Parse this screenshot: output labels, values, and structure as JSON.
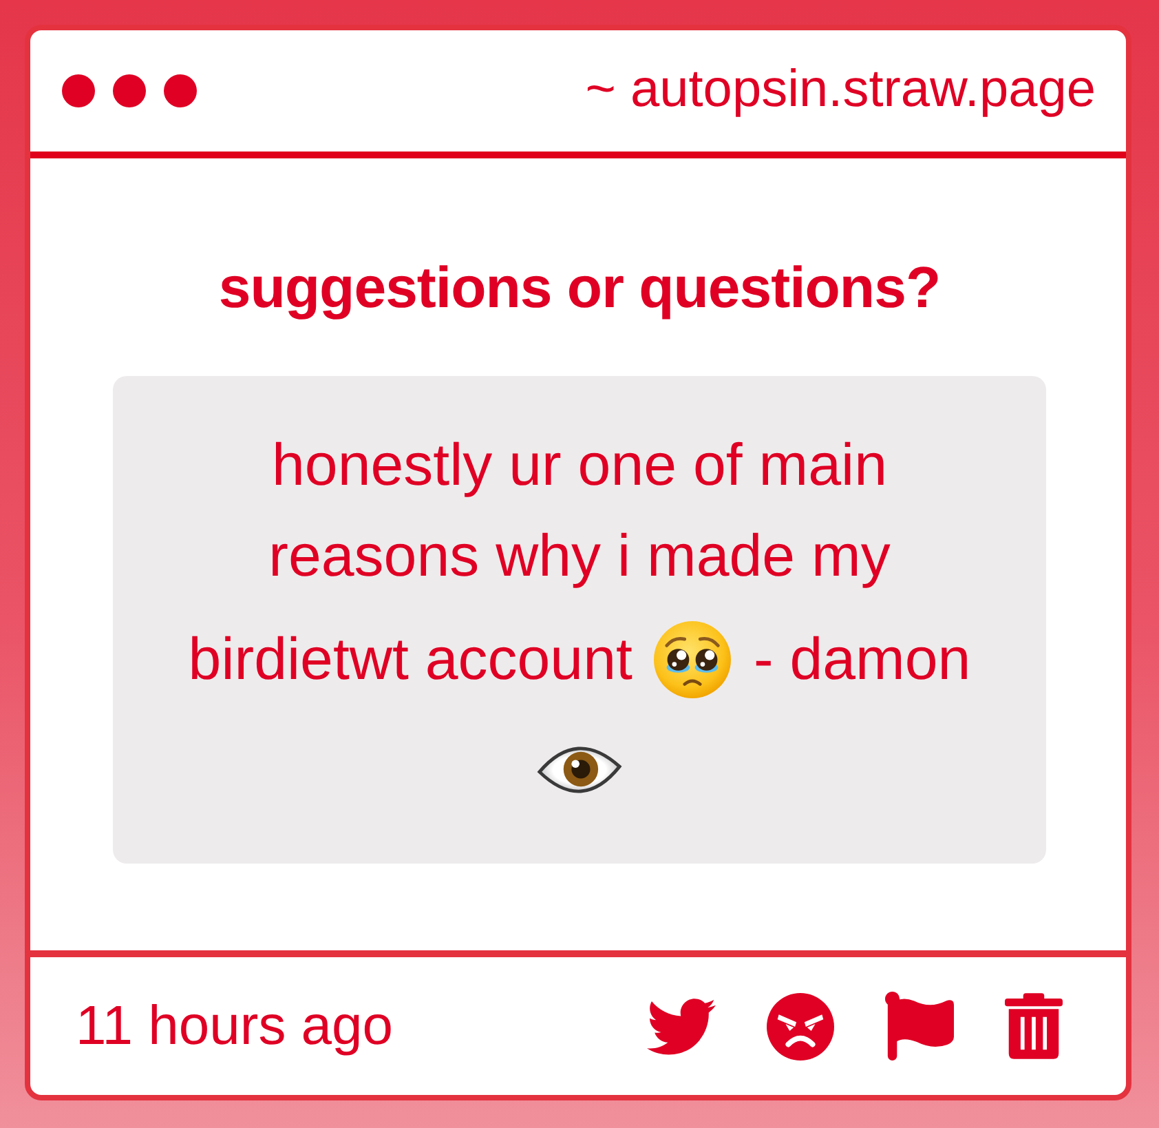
{
  "window": {
    "url": "~ autopsin.straw.page"
  },
  "card": {
    "title": "suggestions or questions?",
    "message": {
      "lines": [
        [
          {
            "kind": "text",
            "text": "honestly ur one of main"
          }
        ],
        [
          {
            "kind": "text",
            "text": "reasons why i made my"
          }
        ],
        [
          {
            "kind": "text",
            "text": "birdietwt account"
          },
          {
            "kind": "pleading"
          },
          {
            "kind": "text",
            "text": "- damon"
          }
        ],
        [
          {
            "kind": "eye"
          }
        ]
      ]
    }
  },
  "footer": {
    "time": "11 hours ago",
    "actions": [
      {
        "kind": "bird"
      },
      {
        "kind": "angry"
      },
      {
        "kind": "flag"
      },
      {
        "kind": "trash"
      }
    ]
  }
}
